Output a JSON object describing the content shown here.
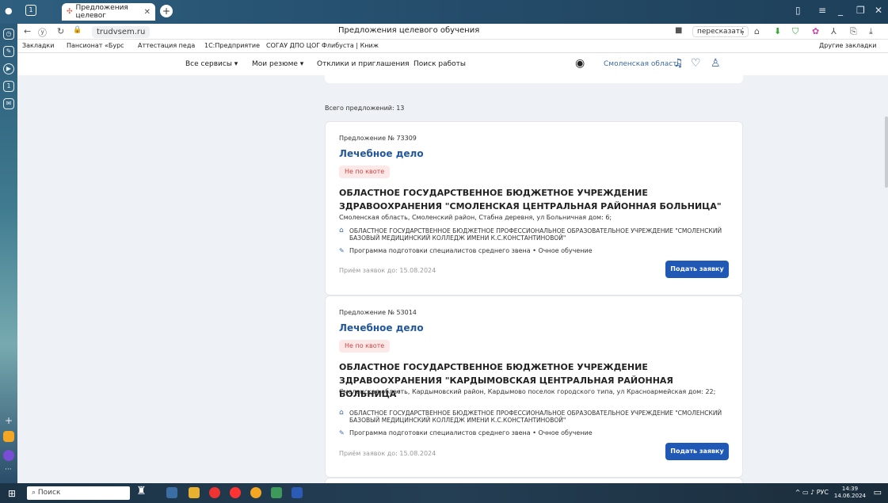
{
  "browser": {
    "tab_title": "Предложения целевог",
    "page_title": "Предложения целевого обучения",
    "url": "trudvsem.ru",
    "translate": "пересказать",
    "other_bookmarks": "Другие закладки"
  },
  "bookmarks": [
    "Закладки",
    "Пансионат «Бурс",
    "Аттестация педа",
    "1С:Предприятие",
    "СОГАУ ДПО ЦОГ",
    "Флибуста | Книж"
  ],
  "header": {
    "menu": [
      "Все сервисы",
      "Мои резюме",
      "Отклики и приглашения",
      "Поиск работы"
    ],
    "region": "Смоленская область"
  },
  "total": "Всего предложений: 13",
  "offers": [
    {
      "number": "Предложение № 73309",
      "specialty": "Лечебное дело",
      "badge": "Не по квоте",
      "org": "ОБЛАСТНОЕ ГОСУДАРСТВЕННОЕ БЮДЖЕТНОЕ УЧРЕЖДЕНИЕ ЗДРАВООХРАНЕНИЯ \"СМОЛЕНСКАЯ ЦЕНТРАЛЬНАЯ РАЙОННАЯ БОЛЬНИЦА\"",
      "address": "Смоленская область, Смоленский район, Стабна деревня, ул Больничная дом: 6;",
      "college": "ОБЛАСТНОЕ ГОСУДАРСТВЕННОЕ БЮДЖЕТНОЕ ПРОФЕССИОНАЛЬНОЕ ОБРАЗОВАТЕЛЬНОЕ УЧРЕЖДЕНИЕ \"СМОЛЕНСКИЙ БАЗОВЫЙ МЕДИЦИНСКИЙ КОЛЛЕДЖ ИМЕНИ К.С.КОНСТАНТИНОВОЙ\"",
      "program": "Программа подготовки специалистов среднего звена • Очное обучение",
      "deadline": "Приём заявок до: 15.08.2024",
      "apply": "Подать заявку"
    },
    {
      "number": "Предложение № 53014",
      "specialty": "Лечебное дело",
      "badge": "Не по квоте",
      "org": "ОБЛАСТНОЕ ГОСУДАРСТВЕННОЕ БЮДЖЕТНОЕ УЧРЕЖДЕНИЕ ЗДРАВООХРАНЕНИЯ \"КАРДЫМОВСКАЯ ЦЕНТРАЛЬНАЯ РАЙОННАЯ БОЛЬНИЦА\"",
      "address": "Смоленская область, Кардымовский район, Кардымово поселок городского типа, ул Красноармейская дом: 22;",
      "college": "ОБЛАСТНОЕ ГОСУДАРСТВЕННОЕ БЮДЖЕТНОЕ ПРОФЕССИОНАЛЬНОЕ ОБРАЗОВАТЕЛЬНОЕ УЧРЕЖДЕНИЕ \"СМОЛЕНСКИЙ БАЗОВЫЙ МЕДИЦИНСКИЙ КОЛЛЕДЖ ИМЕНИ К.С.КОНСТАНТИНОВОЙ\"",
      "program": "Программа подготовки специалистов среднего звена • Очное обучение",
      "deadline": "Приём заявок до: 15.08.2024",
      "apply": "Подать заявку"
    }
  ],
  "taskbar": {
    "search": "Поиск",
    "lang": "РУС",
    "time": "14:39",
    "date": "14.06.2024"
  }
}
